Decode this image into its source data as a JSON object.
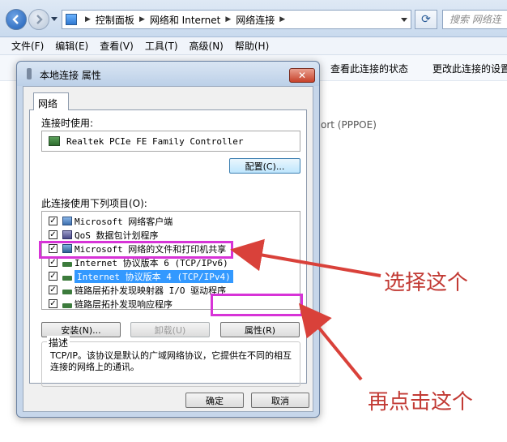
{
  "explorer": {
    "breadcrumbs": [
      "控制面板",
      "网络和 Internet",
      "网络连接"
    ],
    "search_placeholder": "搜索 网络连",
    "menu": [
      "文件(F)",
      "编辑(E)",
      "查看(V)",
      "工具(T)",
      "高级(N)",
      "帮助(H)"
    ],
    "toolbar": [
      "查看此连接的状态",
      "更改此连接的设置"
    ],
    "background_text": "ort (PPPOE)"
  },
  "dialog": {
    "title": "本地连接 属性",
    "close_label": "✕",
    "tab": "网络",
    "connect_using_label": "连接时使用:",
    "adapter": "Realtek PCIe FE Family Controller",
    "configure_button": "配置(C)...",
    "items_label": "此连接使用下列项目(O):",
    "items": [
      {
        "label": "Microsoft 网络客户端",
        "checked": true
      },
      {
        "label": "QoS 数据包计划程序",
        "checked": true
      },
      {
        "label": "Microsoft 网络的文件和打印机共享",
        "checked": true
      },
      {
        "label": "Internet 协议版本 6 (TCP/IPv6)",
        "checked": true
      },
      {
        "label": "Internet 协议版本 4 (TCP/IPv4)",
        "checked": true,
        "selected": true
      },
      {
        "label": "链路层拓扑发现映射器 I/O 驱动程序",
        "checked": true
      },
      {
        "label": "链路层拓扑发现响应程序",
        "checked": true
      }
    ],
    "install_button": "安装(N)...",
    "uninstall_button": "卸载(U)",
    "properties_button": "属性(R)",
    "description_label": "描述",
    "description": "TCP/IP。该协议是默认的广域网络协议，它提供在不同的相互连接的网络上的通讯。",
    "ok_button": "确定",
    "cancel_button": "取消"
  },
  "annotations": {
    "select_this": "选择这个",
    "click_this": "再点击这个",
    "highlight_color": "#d733d7",
    "arrow_color": "#d9413a"
  }
}
